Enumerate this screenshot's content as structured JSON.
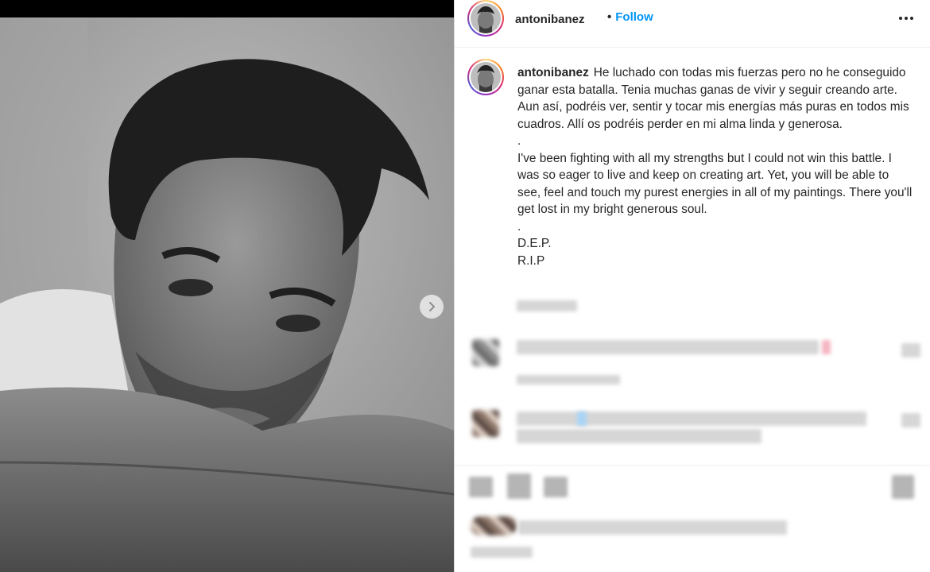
{
  "post": {
    "username": "antonibanez",
    "follow_label": "Follow",
    "separator": "•",
    "more_icon": "more-horizontal-icon",
    "next_icon": "chevron-right-icon"
  },
  "caption": {
    "username": "antonibanez",
    "text": "He luchado con todas mis fuerzas pero no he conseguido ganar esta batalla. Tenia muchas ganas de vivir y seguir creando arte. Aun así, podréis ver, sentir y tocar mis energías más puras en todos mis cuadros. Allí os podréis perder en mi alma linda y generosa.\n.\nI've been fighting with all my strengths but I could not win this battle. I was so eager to live and keep on creating art. Yet, you will be able to see, feel and touch my purest energies in all of my paintings. There you'll get lost in my bright generous soul.\n.\nD.E.P.\nR.I.P"
  },
  "colors": {
    "accent": "#0095f6",
    "text": "#262626",
    "border": "#efefef"
  }
}
